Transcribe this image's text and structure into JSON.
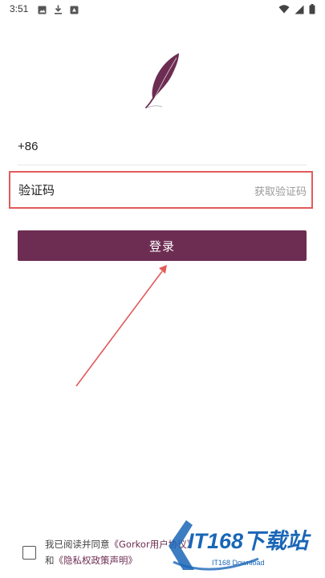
{
  "status_bar": {
    "time": "3:51",
    "left_icons": [
      "image-icon",
      "download-icon",
      "app-icon"
    ],
    "right_icons": [
      "wifi-icon",
      "signal-icon",
      "battery-icon"
    ]
  },
  "logo": {
    "icon": "feather-icon",
    "color": "#6d2d52"
  },
  "phone": {
    "country_code": "+86"
  },
  "code": {
    "placeholder": "验证码",
    "get_code_label": "获取验证码",
    "highlight_color": "#e25b5b"
  },
  "login": {
    "label": "登录",
    "color": "#6d2d52"
  },
  "agreement": {
    "prefix": "我已阅读并同意",
    "user_agreement": "《Gorkor用户协议》",
    "conjunction": "和",
    "privacy_policy": "《隐私权政策声明》"
  },
  "watermark": {
    "brand": "IT168下载站",
    "sub": "IT168 Download",
    "color": "#1a66b7"
  },
  "annotation": {
    "arrow_color": "#e25b5b"
  }
}
